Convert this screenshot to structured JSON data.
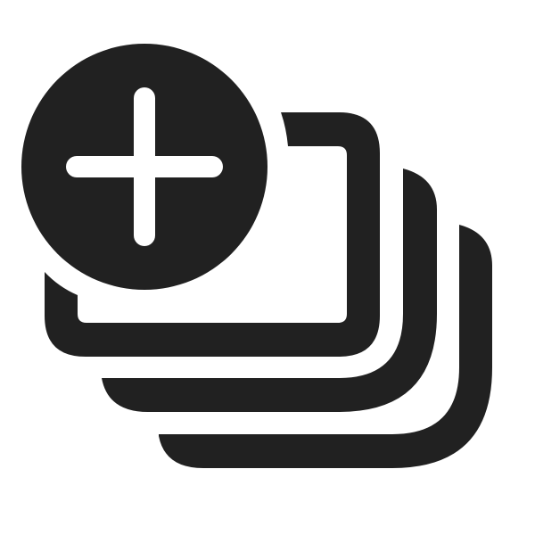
{
  "icon": {
    "name": "add-multiple-cards-icon",
    "color": "#212121",
    "background": "#ffffff"
  }
}
